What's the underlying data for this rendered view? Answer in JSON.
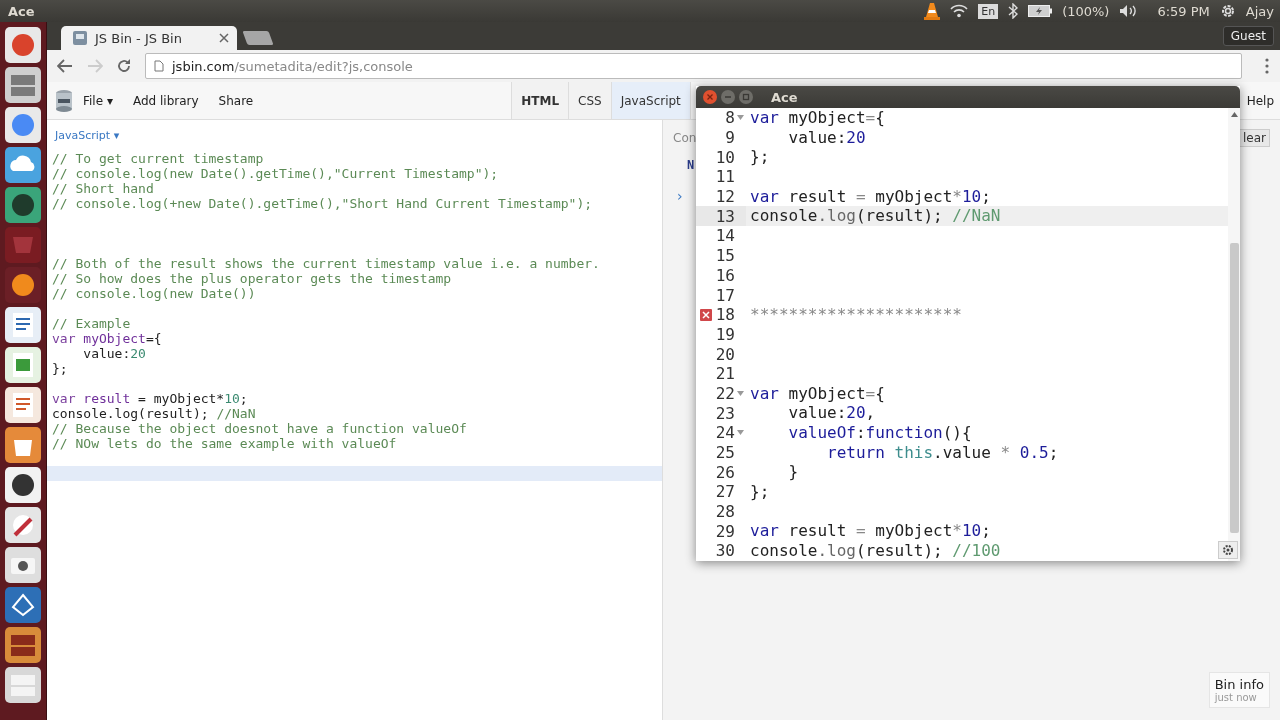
{
  "top_panel": {
    "app_title": "Ace",
    "keyboard_layout": "En",
    "battery": "(100%)",
    "clock": "6:59 PM",
    "user": "Ajay"
  },
  "browser": {
    "tab_title": "JS Bin - JS Bin",
    "guest": "Guest",
    "url_host": "jsbin.com",
    "url_path": "/sumetadita/edit?js,console"
  },
  "jsbin": {
    "menu": [
      "File ▾",
      "Add library",
      "Share"
    ],
    "panels": [
      {
        "label": "HTML",
        "selected": false,
        "bold": true
      },
      {
        "label": "CSS",
        "selected": false,
        "bold": false
      },
      {
        "label": "JavaScript",
        "selected": true,
        "bold": false
      }
    ],
    "help": "Help"
  },
  "editor": {
    "language": "JavaScript ▾",
    "lines": [
      {
        "active": false,
        "tokens": [
          {
            "kind": "comment",
            "text": "// To get current timestamp"
          }
        ]
      },
      {
        "active": false,
        "tokens": [
          {
            "kind": "comment",
            "text": "// console.log(new Date().getTime(),\"Current Timestamp\");"
          }
        ]
      },
      {
        "active": false,
        "tokens": [
          {
            "kind": "comment",
            "text": "// Short hand"
          }
        ]
      },
      {
        "active": false,
        "tokens": [
          {
            "kind": "comment",
            "text": "// console.log(+new Date().getTime(),\"Short Hand Current Timestamp\");"
          }
        ]
      },
      {
        "active": false
      },
      {
        "active": false
      },
      {
        "active": false
      },
      {
        "active": false,
        "tokens": [
          {
            "kind": "comment",
            "text": "// Both of the result shows the current timestamp value i.e. a number."
          }
        ]
      },
      {
        "active": false,
        "tokens": [
          {
            "kind": "comment",
            "text": "// So how does the plus operator gets the timestamp"
          }
        ]
      },
      {
        "active": false,
        "tokens": [
          {
            "kind": "comment",
            "text": "// console.log(new Date())"
          }
        ]
      },
      {
        "active": false
      },
      {
        "active": false,
        "tokens": [
          {
            "kind": "comment",
            "text": "// Example"
          }
        ]
      },
      {
        "active": false,
        "tokens": [
          {
            "kind": "keyword",
            "text": "var "
          },
          {
            "kind": "variable",
            "text": "myObject"
          },
          {
            "kind": "plain",
            "text": "={"
          }
        ]
      },
      {
        "active": false,
        "tokens": [
          {
            "kind": "plain",
            "text": "    value:"
          },
          {
            "kind": "number",
            "text": "20"
          }
        ]
      },
      {
        "active": false,
        "tokens": [
          {
            "kind": "plain",
            "text": "};"
          }
        ]
      },
      {
        "active": false
      },
      {
        "active": false,
        "tokens": [
          {
            "kind": "keyword",
            "text": "var "
          },
          {
            "kind": "variable",
            "text": "result"
          },
          {
            "kind": "plain",
            "text": " = myObject*"
          },
          {
            "kind": "number",
            "text": "10"
          },
          {
            "kind": "plain",
            "text": ";"
          }
        ]
      },
      {
        "active": false,
        "tokens": [
          {
            "kind": "plain",
            "text": "console.log(result); "
          },
          {
            "kind": "comment",
            "text": "//NaN"
          }
        ]
      },
      {
        "active": false,
        "tokens": [
          {
            "kind": "comment",
            "text": "// Because the object doesnot have a function valueOf"
          }
        ]
      },
      {
        "active": false,
        "tokens": [
          {
            "kind": "comment",
            "text": "// NOw lets do the same example with valueOf"
          }
        ]
      },
      {
        "active": false
      },
      {
        "active": true
      }
    ]
  },
  "console": {
    "header": "Con",
    "output": "N",
    "prompt": "›",
    "clear": "lear"
  },
  "ace": {
    "title": "Ace",
    "lines": [
      {
        "number": "8",
        "fold": true,
        "error": false,
        "active": false,
        "tokens": [
          {
            "kind": "keyword",
            "text": "var "
          },
          {
            "kind": "plain",
            "text": "myObject"
          },
          {
            "kind": "operator",
            "text": "="
          },
          {
            "kind": "plain",
            "text": "{"
          }
        ]
      },
      {
        "number": "9",
        "fold": false,
        "error": false,
        "active": false,
        "tokens": [
          {
            "kind": "plain",
            "text": "    value:"
          },
          {
            "kind": "number",
            "text": "20"
          }
        ]
      },
      {
        "number": "10",
        "fold": false,
        "error": false,
        "active": false,
        "tokens": [
          {
            "kind": "plain",
            "text": "};"
          }
        ]
      },
      {
        "number": "11",
        "fold": false,
        "error": false,
        "active": false
      },
      {
        "number": "12",
        "fold": false,
        "error": false,
        "active": false,
        "tokens": [
          {
            "kind": "keyword",
            "text": "var "
          },
          {
            "kind": "plain",
            "text": "result "
          },
          {
            "kind": "operator",
            "text": "="
          },
          {
            "kind": "plain",
            "text": " myObject"
          },
          {
            "kind": "operator",
            "text": "*"
          },
          {
            "kind": "number",
            "text": "10"
          },
          {
            "kind": "plain",
            "text": ";"
          }
        ]
      },
      {
        "number": "13",
        "fold": false,
        "error": false,
        "active": true,
        "tokens": [
          {
            "kind": "plain",
            "text": "console"
          },
          {
            "kind": "method",
            "text": ".log"
          },
          {
            "kind": "plain",
            "text": "(result); "
          },
          {
            "kind": "comment",
            "text": "//NaN"
          }
        ]
      },
      {
        "number": "14",
        "fold": false,
        "error": false,
        "active": false
      },
      {
        "number": "15",
        "fold": false,
        "error": false,
        "active": false
      },
      {
        "number": "16",
        "fold": false,
        "error": false,
        "active": false
      },
      {
        "number": "17",
        "fold": false,
        "error": false,
        "active": false
      },
      {
        "number": "18",
        "fold": false,
        "error": true,
        "active": false,
        "tokens": [
          {
            "kind": "operator",
            "text": "**********************"
          }
        ]
      },
      {
        "number": "19",
        "fold": false,
        "error": false,
        "active": false
      },
      {
        "number": "20",
        "fold": false,
        "error": false,
        "active": false
      },
      {
        "number": "21",
        "fold": false,
        "error": false,
        "active": false
      },
      {
        "number": "22",
        "fold": true,
        "error": false,
        "active": false,
        "tokens": [
          {
            "kind": "keyword",
            "text": "var "
          },
          {
            "kind": "plain",
            "text": "myObject"
          },
          {
            "kind": "operator",
            "text": "="
          },
          {
            "kind": "plain",
            "text": "{"
          }
        ]
      },
      {
        "number": "23",
        "fold": false,
        "error": false,
        "active": false,
        "tokens": [
          {
            "kind": "plain",
            "text": "    value:"
          },
          {
            "kind": "number",
            "text": "20"
          },
          {
            "kind": "plain",
            "text": ","
          }
        ]
      },
      {
        "number": "24",
        "fold": true,
        "error": false,
        "active": false,
        "tokens": [
          {
            "kind": "function",
            "text": "    valueOf"
          },
          {
            "kind": "plain",
            "text": ":"
          },
          {
            "kind": "function",
            "text": "function"
          },
          {
            "kind": "plain",
            "text": "(){"
          }
        ]
      },
      {
        "number": "25",
        "fold": false,
        "error": false,
        "active": false,
        "tokens": [
          {
            "kind": "keyword",
            "text": "        return "
          },
          {
            "kind": "this",
            "text": "this"
          },
          {
            "kind": "plain",
            "text": ".value "
          },
          {
            "kind": "operator",
            "text": "*"
          },
          {
            "kind": "number",
            "text": " 0.5"
          },
          {
            "kind": "plain",
            "text": ";"
          }
        ]
      },
      {
        "number": "26",
        "fold": false,
        "error": false,
        "active": false,
        "tokens": [
          {
            "kind": "plain",
            "text": "    }"
          }
        ]
      },
      {
        "number": "27",
        "fold": false,
        "error": false,
        "active": false,
        "tokens": [
          {
            "kind": "plain",
            "text": "};"
          }
        ]
      },
      {
        "number": "28",
        "fold": false,
        "error": false,
        "active": false
      },
      {
        "number": "29",
        "fold": false,
        "error": false,
        "active": false,
        "tokens": [
          {
            "kind": "keyword",
            "text": "var "
          },
          {
            "kind": "plain",
            "text": "result "
          },
          {
            "kind": "operator",
            "text": "="
          },
          {
            "kind": "plain",
            "text": " myObject"
          },
          {
            "kind": "operator",
            "text": "*"
          },
          {
            "kind": "number",
            "text": "10"
          },
          {
            "kind": "plain",
            "text": ";"
          }
        ]
      },
      {
        "number": "30",
        "fold": false,
        "error": false,
        "active": false,
        "tokens": [
          {
            "kind": "plain",
            "text": "console"
          },
          {
            "kind": "method",
            "text": ".log"
          },
          {
            "kind": "plain",
            "text": "(result); "
          },
          {
            "kind": "comment",
            "text": "//100"
          }
        ]
      }
    ]
  },
  "bin_info": {
    "title": "Bin info",
    "time": "just now"
  }
}
